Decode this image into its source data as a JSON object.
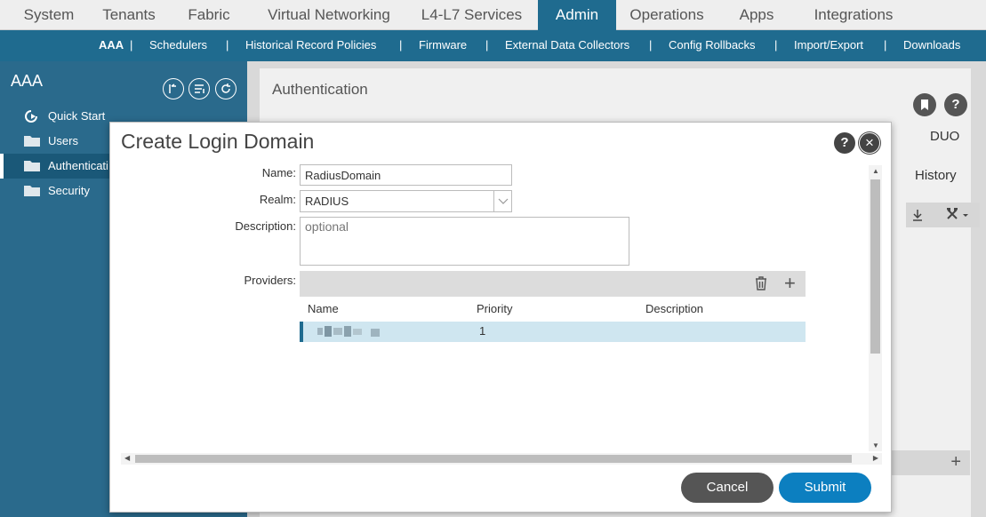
{
  "topnav": {
    "tabs": [
      {
        "label": "System"
      },
      {
        "label": "Tenants"
      },
      {
        "label": "Fabric"
      },
      {
        "label": "Virtual Networking"
      },
      {
        "label": "L4-L7 Services"
      },
      {
        "label": "Admin"
      },
      {
        "label": "Operations"
      },
      {
        "label": "Apps"
      },
      {
        "label": "Integrations"
      }
    ],
    "active": "Admin"
  },
  "subnav": {
    "items": [
      {
        "label": "AAA"
      },
      {
        "label": "Schedulers"
      },
      {
        "label": "Historical Record Policies"
      },
      {
        "label": "Firmware"
      },
      {
        "label": "External Data Collectors"
      },
      {
        "label": "Config Rollbacks"
      },
      {
        "label": "Import/Export"
      },
      {
        "label": "Downloads"
      }
    ],
    "separator": "|"
  },
  "sidebar": {
    "title": "AAA",
    "items": [
      {
        "label": "Quick Start",
        "icon": "quick-start-icon"
      },
      {
        "label": "Users",
        "icon": "folder-icon"
      },
      {
        "label": "Authenticati",
        "icon": "folder-icon"
      },
      {
        "label": "Security",
        "icon": "folder-icon"
      }
    ],
    "active_index": 2
  },
  "main": {
    "panel_title": "Authentication",
    "bookmark_icon": "bookmark-icon",
    "help_label": "?",
    "tab_duo": "DUO",
    "tab_history": "History",
    "plus_label": "+"
  },
  "modal": {
    "title": "Create Login Domain",
    "help_label": "?",
    "close_label": "×",
    "fields": {
      "name_label": "Name:",
      "name_value": "RadiusDomain",
      "realm_label": "Realm:",
      "realm_value": "RADIUS",
      "description_label": "Description:",
      "description_placeholder": "optional",
      "providers_label": "Providers:"
    },
    "providers_table": {
      "columns": [
        "Name",
        "Priority",
        "Description"
      ],
      "rows": [
        {
          "name": "",
          "priority": "1",
          "description": ""
        }
      ],
      "plus_label": "+"
    },
    "buttons": {
      "cancel": "Cancel",
      "submit": "Submit"
    }
  },
  "colors": {
    "accent": "#1f6b8f",
    "submit": "#0c7fc0",
    "cancel": "#555555",
    "selected_row": "#cfe6f0"
  }
}
